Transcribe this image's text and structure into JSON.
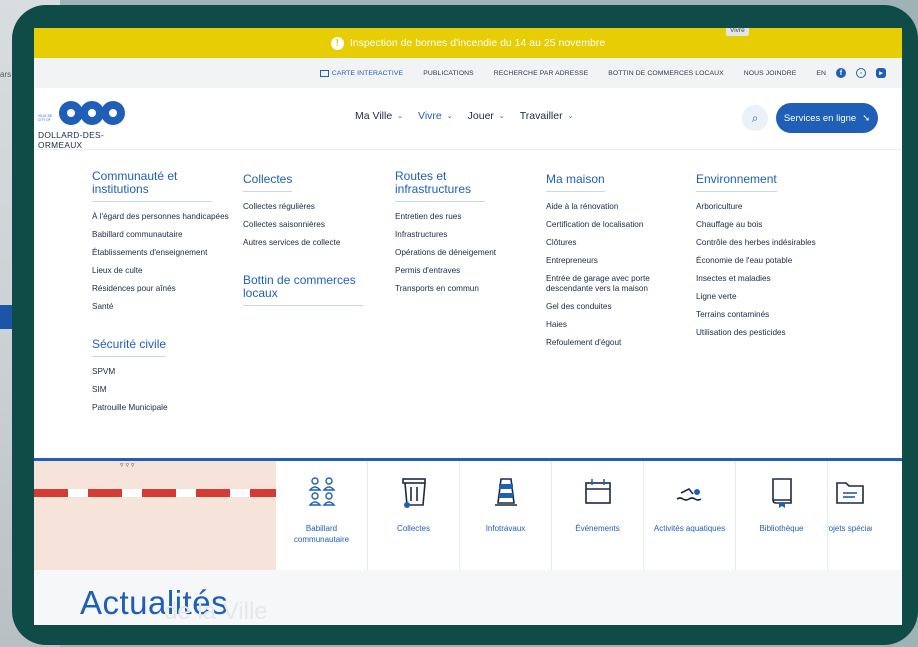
{
  "alert": {
    "text": "Inspection de bornes d'incendie du 14 au 25 novembre",
    "icon": "info-icon"
  },
  "bg": {
    "cut_text": "ars"
  },
  "utility_nav": {
    "items": [
      "CARTE INTERACTIVE",
      "PUBLICATIONS",
      "RECHERCHE PAR ADRESSE",
      "BOTTIN DE COMMERCES LOCAUX",
      "NOUS JOINDRE",
      "EN"
    ]
  },
  "logo": {
    "mini_line1": "VILLE DE",
    "mini_line2": "CITY OF",
    "wordmark": "DOLLARD-DES-ORMEAUX"
  },
  "main_nav": {
    "items": [
      "Ma Ville",
      "Vivre",
      "Jouer",
      "Travailler"
    ],
    "active": "Vivre",
    "services_label": "Services en ligne"
  },
  "tooltip": "Vivre",
  "mega_menu": {
    "col1": {
      "heading": "Communauté et institutions",
      "items": [
        "À l'égard des personnes handicapées",
        "Babillard communautaire",
        "Établissements d'enseignement",
        "Lieux de culte",
        "Résidences pour aînés",
        "Santé"
      ],
      "heading2": "Sécurité civile",
      "items2": [
        "SPVM",
        "SIM",
        "Patrouille Municipale"
      ]
    },
    "col2": {
      "heading": "Collectes",
      "items": [
        "Collectes régulières",
        "Collectes saisonnières",
        "Autres services de collecte"
      ],
      "heading2": "Bottin de commerces locaux"
    },
    "col3": {
      "heading": "Routes et infrastructures",
      "items": [
        "Entretien des rues",
        "Infrastructures",
        "Opérations de déneigement",
        "Permis d'entraves",
        "Transports en commun"
      ]
    },
    "col4": {
      "heading": "Ma maison",
      "items": [
        "Aide à la rénovation",
        "Certification de localisation",
        "Clôtures",
        "Entrepreneurs",
        "Entrée de garage avec porte descendante vers la maison",
        "Gel des conduites",
        "Haies",
        "Refoulement d'égout"
      ]
    },
    "col5": {
      "heading": "Environnement",
      "items": [
        "Arboriculture",
        "Chauffage au bois",
        "Contrôle des herbes indésirables",
        "Économie de l'eau potable",
        "Insectes et maladies",
        "Ligne verte",
        "Terrains contaminés",
        "Utilisation des pesticides"
      ]
    }
  },
  "quick_links": [
    "Babillard communautaire",
    "Collectes",
    "Infotravaux",
    "Événements",
    "Activités aquatiques",
    "Bibliothèque",
    "Projets spéciaux"
  ],
  "news": {
    "title": "Actualités",
    "ghost": "de la Ville"
  },
  "colors": {
    "primary": "#1f5fb8",
    "alert": "#e7cd03",
    "frame": "#0f4c47"
  }
}
